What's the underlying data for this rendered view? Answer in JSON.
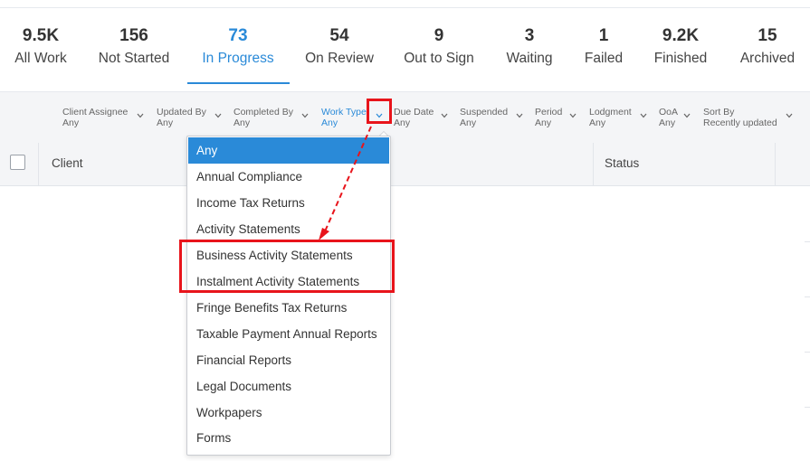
{
  "stats": [
    {
      "count": "9.5K",
      "label": "All Work"
    },
    {
      "count": "156",
      "label": "Not Started"
    },
    {
      "count": "73",
      "label": "In Progress"
    },
    {
      "count": "54",
      "label": "On Review"
    },
    {
      "count": "9",
      "label": "Out to Sign"
    },
    {
      "count": "3",
      "label": "Waiting"
    },
    {
      "count": "1",
      "label": "Failed"
    },
    {
      "count": "9.2K",
      "label": "Finished"
    },
    {
      "count": "15",
      "label": "Archived"
    }
  ],
  "active_tab": "In Progress",
  "filters": [
    {
      "label": "Client Assignee",
      "value": "Any"
    },
    {
      "label": "Updated By",
      "value": "Any"
    },
    {
      "label": "Completed By",
      "value": "Any"
    },
    {
      "label": "Work Type",
      "value": "Any"
    },
    {
      "label": "Due Date",
      "value": "Any"
    },
    {
      "label": "Suspended",
      "value": "Any"
    },
    {
      "label": "Period",
      "value": "Any"
    },
    {
      "label": "Lodgment",
      "value": "Any"
    },
    {
      "label": "OoA",
      "value": "Any"
    },
    {
      "label": "Sort By",
      "value": "Recently updated"
    }
  ],
  "table": {
    "columns": [
      "Client",
      "Status"
    ]
  },
  "dropdown": {
    "items": [
      "Any",
      "Annual Compliance",
      "Income Tax Returns",
      "Activity Statements",
      "Business Activity Statements",
      "Instalment Activity Statements",
      "Fringe Benefits Tax Returns",
      "Taxable Payment Annual Reports",
      "Financial Reports",
      "Legal Documents",
      "Workpapers",
      "Forms"
    ],
    "selected": "Any"
  },
  "colors": {
    "accent": "#2a8ad8",
    "highlight": "#e8141b",
    "filter_bg": "#f4f5f7"
  }
}
